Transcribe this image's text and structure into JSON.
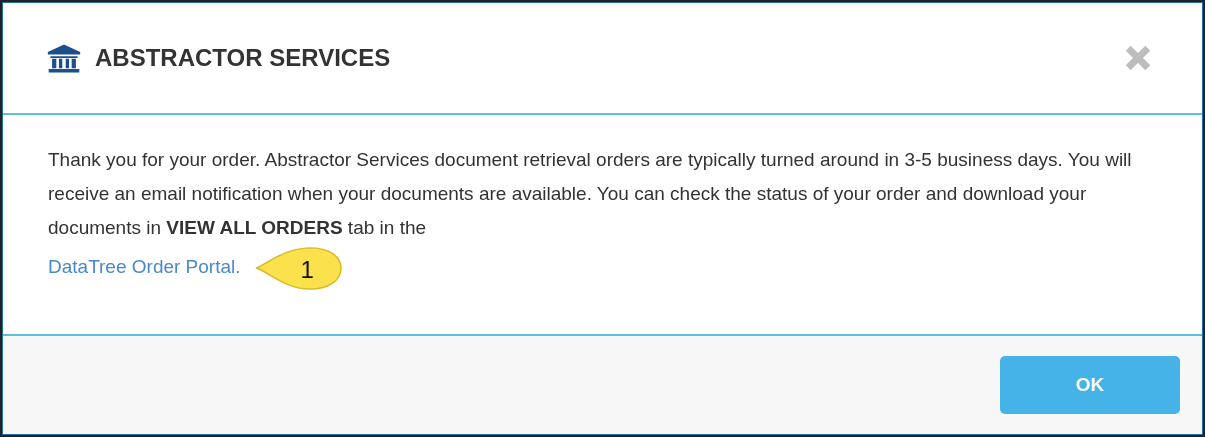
{
  "dialog": {
    "title": "ABSTRACTOR SERVICES",
    "message": "Thank you for your order. Abstractor Services document retrieval orders are typically turned around in 3-5 business days. You will receive an email notification when your documents are available. You can check the status of your order and download your documents in **VIEW ALL ORDERS** tab in the",
    "link": "DataTree Order Portal.",
    "callout": "1",
    "buttons": [
      "OK"
    ]
  }
}
